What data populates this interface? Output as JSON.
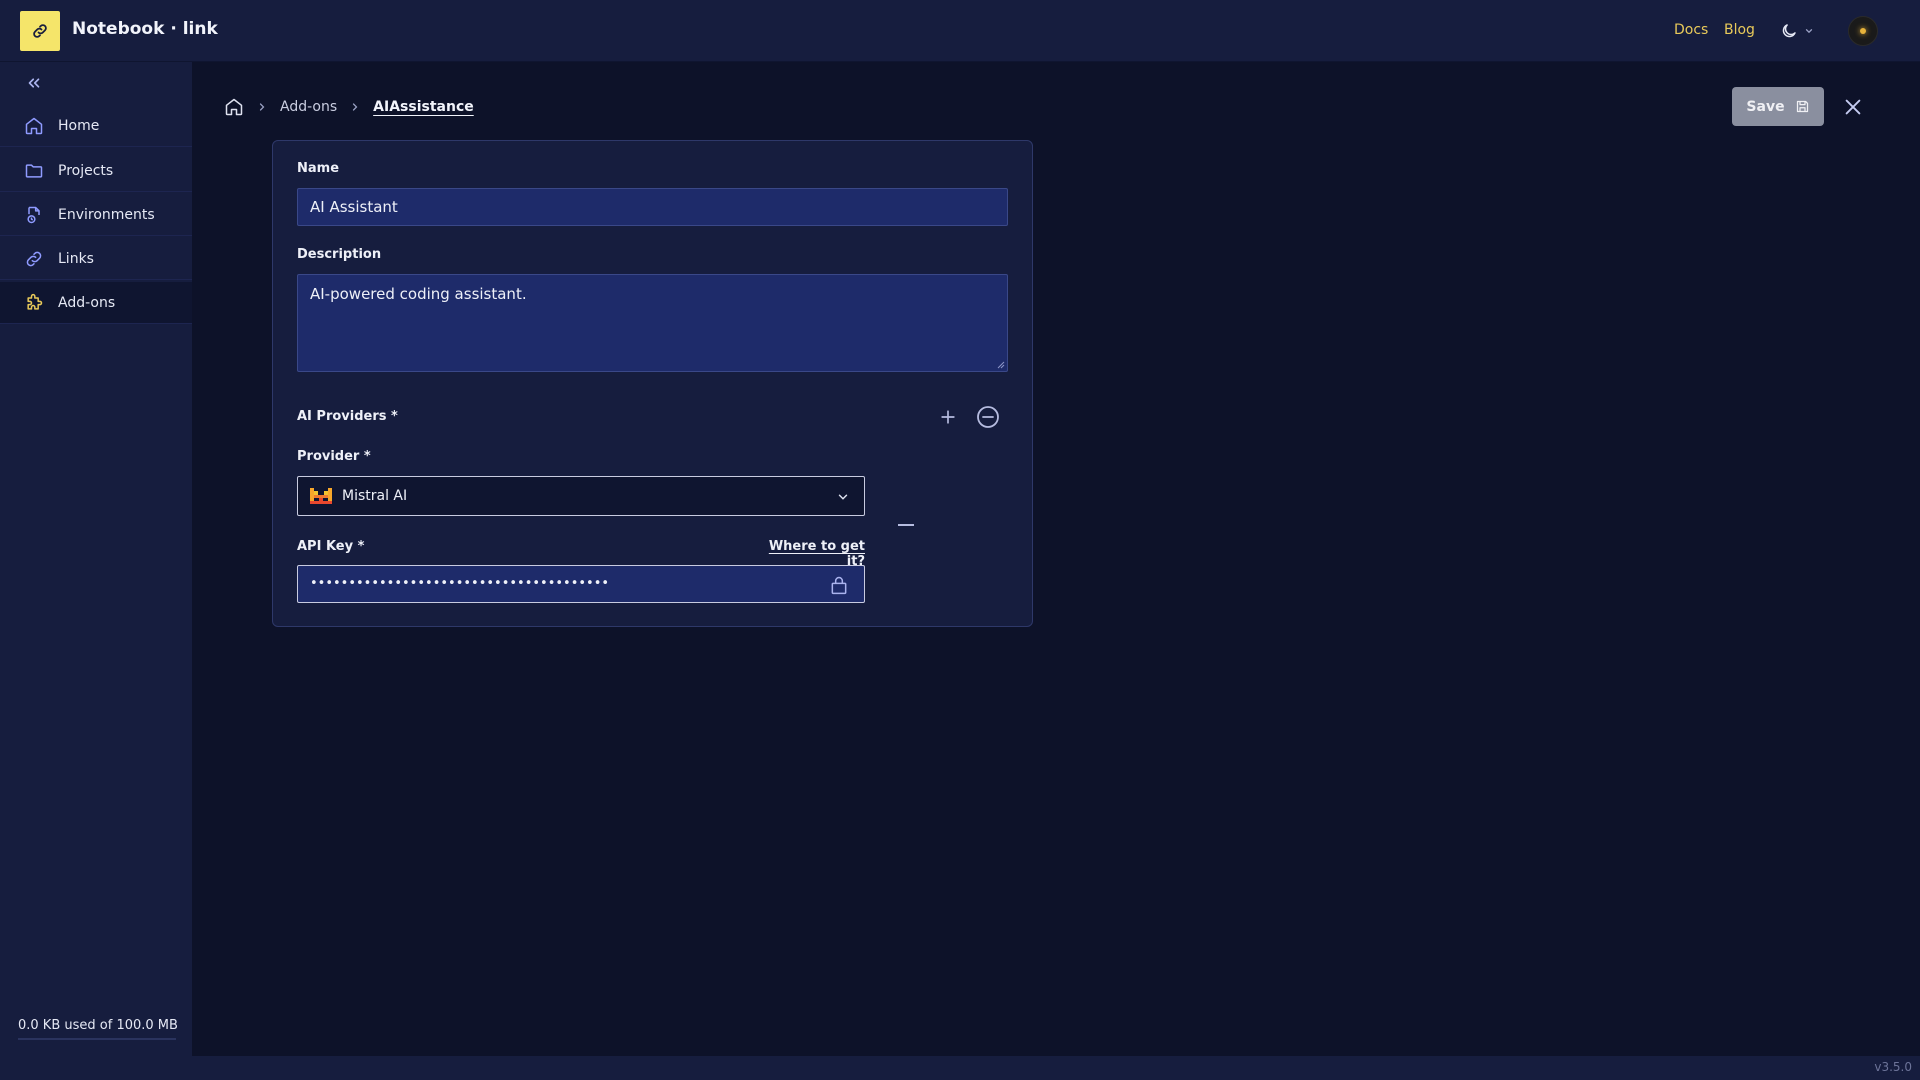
{
  "app": {
    "title": "Notebook · link",
    "logo_icon": "link-icon"
  },
  "header": {
    "links": [
      {
        "label": "Docs"
      },
      {
        "label": "Blog"
      }
    ],
    "theme_icon": "moon-icon",
    "colors": {
      "link": "#e8c95a",
      "logo_bg": "#f5e56a"
    }
  },
  "sidebar": {
    "items": [
      {
        "label": "Home",
        "icon": "home-icon"
      },
      {
        "label": "Projects",
        "icon": "folder-icon"
      },
      {
        "label": "Environments",
        "icon": "environment-icon"
      },
      {
        "label": "Links",
        "icon": "link-icon"
      },
      {
        "label": "Add-ons",
        "icon": "puzzle-icon",
        "active": true
      }
    ],
    "storage": "0.0 KB used of 100.0 MB"
  },
  "breadcrumb": {
    "items": [
      "Add-ons",
      "AIAssistance"
    ]
  },
  "toolbar": {
    "save_label": "Save"
  },
  "form": {
    "name_label": "Name",
    "name_value": "AI Assistant",
    "description_label": "Description",
    "description_value": "AI-powered coding assistant.",
    "providers_label": "AI Providers *",
    "provider_label": "Provider *",
    "provider_value": "Mistral AI",
    "api_key_label": "API Key *",
    "api_key_link": "Where to get it?",
    "api_key_value": "•••••••••••••••••••••••••••••••••••••••"
  },
  "footer": {
    "version": "v3.5.0"
  }
}
